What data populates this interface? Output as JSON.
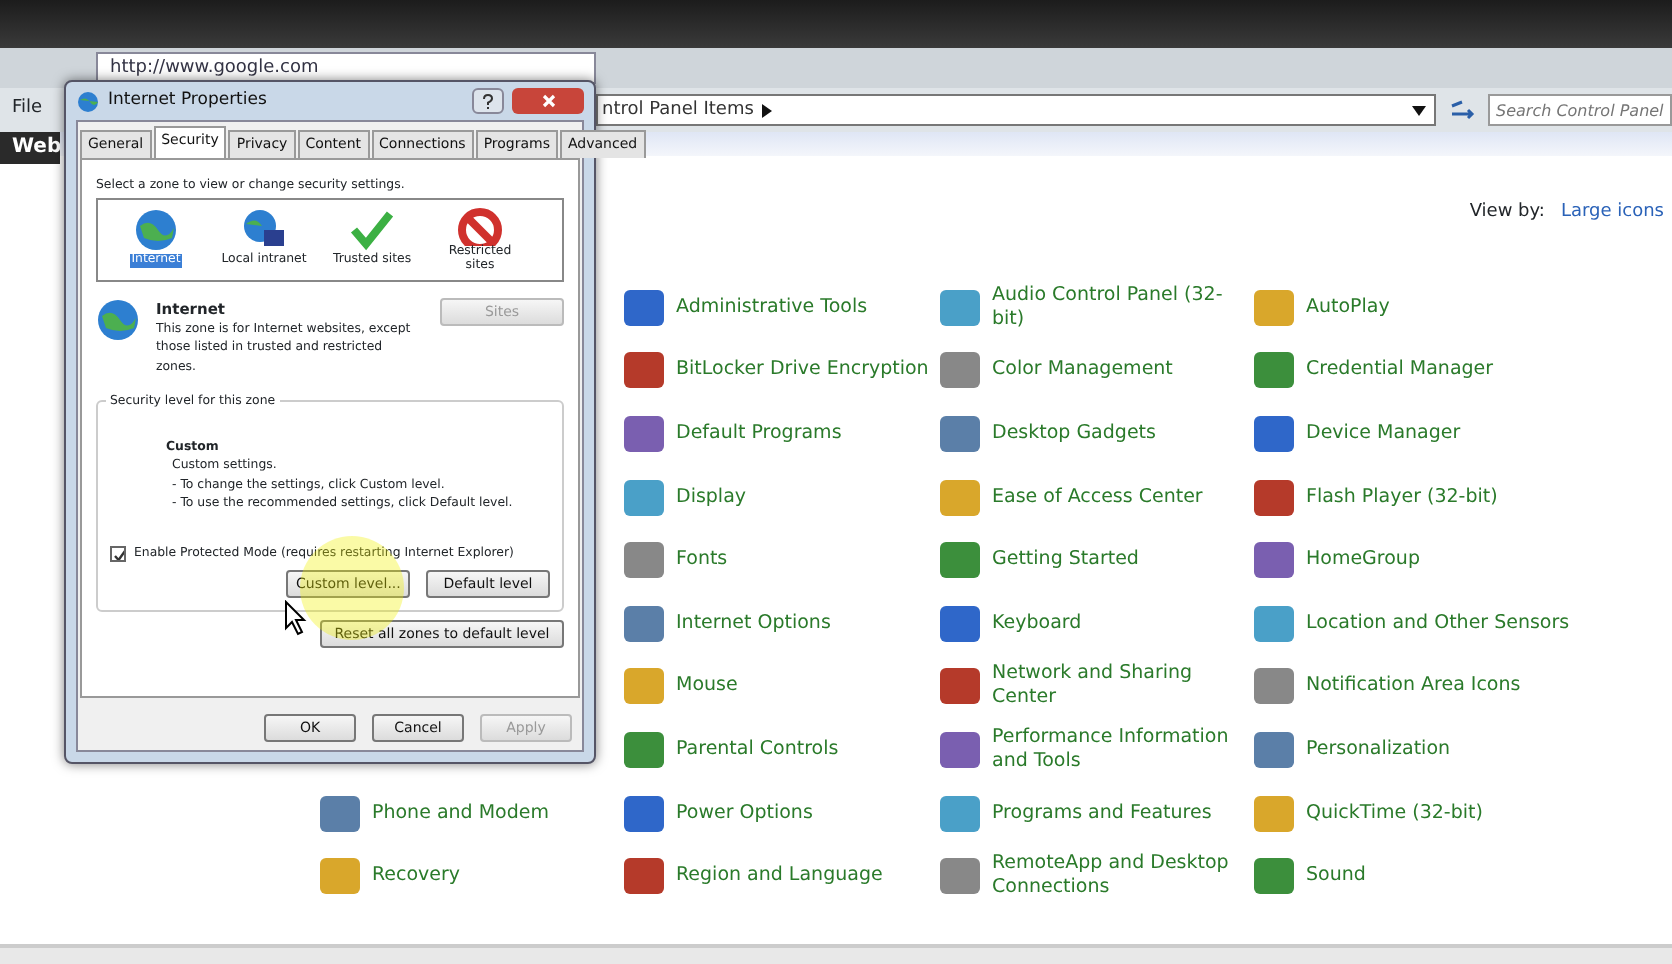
{
  "browser": {
    "url": "http://www.google.com",
    "menu": "File",
    "tab": "Web"
  },
  "control_panel": {
    "breadcrumb": "ntrol Panel Items",
    "search": {
      "placeholder": "Search Control Panel"
    },
    "view_by_label": "View by:",
    "view_by_value": "Large icons",
    "columns": [
      [
        {
          "label": "Phone and Modem"
        },
        {
          "label": "Recovery"
        }
      ],
      [
        {
          "label": "Administrative Tools"
        },
        {
          "label": "BitLocker Drive Encryption"
        },
        {
          "label": "Default Programs"
        },
        {
          "label": "Display"
        },
        {
          "label": "Fonts"
        },
        {
          "label": "Internet Options"
        },
        {
          "label": "Mouse"
        },
        {
          "label": "Parental Controls"
        },
        {
          "label": "Power Options"
        },
        {
          "label": "Region and Language"
        }
      ],
      [
        {
          "label": "Audio Control Panel (32-bit)"
        },
        {
          "label": "Color Management"
        },
        {
          "label": "Desktop Gadgets"
        },
        {
          "label": "Ease of Access Center"
        },
        {
          "label": "Getting Started"
        },
        {
          "label": "Keyboard"
        },
        {
          "label": "Network and Sharing Center"
        },
        {
          "label": "Performance Information and Tools"
        },
        {
          "label": "Programs and Features"
        },
        {
          "label": "RemoteApp and Desktop Connections"
        }
      ],
      [
        {
          "label": "AutoPlay"
        },
        {
          "label": "Credential Manager"
        },
        {
          "label": "Device Manager"
        },
        {
          "label": "Flash Player (32-bit)"
        },
        {
          "label": "HomeGroup"
        },
        {
          "label": "Location and Other Sensors"
        },
        {
          "label": "Notification Area Icons"
        },
        {
          "label": "Personalization"
        },
        {
          "label": "QuickTime (32-bit)"
        },
        {
          "label": "Sound"
        }
      ]
    ]
  },
  "dialog": {
    "title": "Internet Properties",
    "tabs": [
      {
        "label": "General",
        "selected": false
      },
      {
        "label": "Security",
        "selected": true
      },
      {
        "label": "Privacy",
        "selected": false
      },
      {
        "label": "Content",
        "selected": false
      },
      {
        "label": "Connections",
        "selected": false
      },
      {
        "label": "Programs",
        "selected": false
      },
      {
        "label": "Advanced",
        "selected": false
      }
    ],
    "zone_prompt": "Select a zone to view or change security settings.",
    "zones": [
      {
        "label": "Internet",
        "kind": "globe",
        "selected": true
      },
      {
        "label": "Local intranet",
        "kind": "intranet",
        "selected": false
      },
      {
        "label": "Trusted sites",
        "kind": "check",
        "selected": false
      },
      {
        "label": "Restricted sites",
        "kind": "blocked",
        "selected": false
      }
    ],
    "zone_name": "Internet",
    "zone_description": "This zone is for Internet websites, except those listed in trusted and restricted zones.",
    "sites_button": {
      "label": "Sites",
      "disabled": true
    },
    "level_group": "Security level for this zone",
    "level_name": "Custom",
    "level_lines": [
      "Custom settings.",
      "- To change the settings, click Custom level.",
      "- To use the recommended settings, click Default level."
    ],
    "protected_mode": {
      "label": "Enable Protected Mode (requires restarting Internet Explorer)",
      "checked": true
    },
    "level_buttons": [
      {
        "label": "Custom level..."
      },
      {
        "label": "Default level"
      }
    ],
    "reset_button": "Reset all zones to default level",
    "footer_buttons": [
      {
        "label": "OK",
        "disabled": false
      },
      {
        "label": "Cancel",
        "disabled": false
      },
      {
        "label": "Apply",
        "disabled": true
      }
    ]
  }
}
